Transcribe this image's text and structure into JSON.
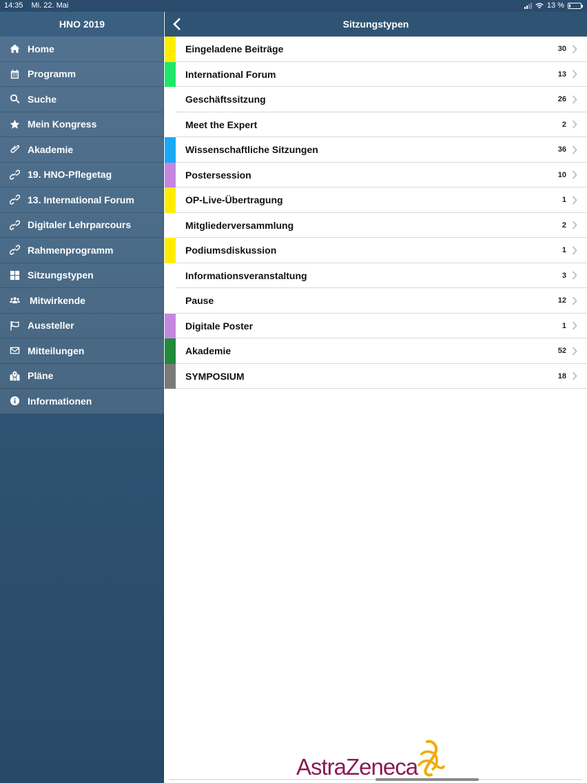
{
  "status_bar": {
    "time": "14:35",
    "date": "Mi. 22. Mai",
    "battery": "13 %",
    "battery_level": 0.13
  },
  "sidebar": {
    "title": "HNO 2019",
    "items": [
      {
        "label": "Home",
        "icon": "home-icon"
      },
      {
        "label": "Programm",
        "icon": "calendar-icon"
      },
      {
        "label": "Suche",
        "icon": "search-icon"
      },
      {
        "label": "Mein Kongress",
        "icon": "star-icon"
      },
      {
        "label": "Akademie",
        "icon": "paperclip-icon"
      },
      {
        "label": "19. HNO-Pflegetag",
        "icon": "link-icon"
      },
      {
        "label": "13. International Forum",
        "icon": "link-icon"
      },
      {
        "label": "Digitaler Lehrparcours",
        "icon": "link-icon"
      },
      {
        "label": "Rahmenprogramm",
        "icon": "link-icon"
      },
      {
        "label": "Sitzungstypen",
        "icon": "grid-icon"
      },
      {
        "label": "Mitwirkende",
        "icon": "users-icon"
      },
      {
        "label": "Aussteller",
        "icon": "flag-icon"
      },
      {
        "label": "Mitteilungen",
        "icon": "envelope-icon"
      },
      {
        "label": "Pläne",
        "icon": "map-icon"
      },
      {
        "label": "Informationen",
        "icon": "info-icon"
      }
    ]
  },
  "nav": {
    "title": "Sitzungstypen"
  },
  "session_types": [
    {
      "label": "Eingeladene Beiträge",
      "count": "30",
      "color": "#ffed00"
    },
    {
      "label": "International Forum",
      "count": "13",
      "color": "#1ee86a"
    },
    {
      "label": "Geschäftssitzung",
      "count": "26",
      "color": ""
    },
    {
      "label": "Meet the Expert",
      "count": "2",
      "color": ""
    },
    {
      "label": "Wissenschaftliche Sitzungen",
      "count": "36",
      "color": "#1aa9f5"
    },
    {
      "label": "Postersession",
      "count": "10",
      "color": "#c487e0"
    },
    {
      "label": "OP-Live-Übertragung",
      "count": "1",
      "color": "#ffed00"
    },
    {
      "label": "Mitgliederversammlung",
      "count": "2",
      "color": ""
    },
    {
      "label": "Podiumsdiskussion",
      "count": "1",
      "color": "#ffed00"
    },
    {
      "label": "Informationsveranstaltung",
      "count": "3",
      "color": ""
    },
    {
      "label": "Pause",
      "count": "12",
      "color": ""
    },
    {
      "label": "Digitale Poster",
      "count": "1",
      "color": "#c487e0"
    },
    {
      "label": "Akademie",
      "count": "52",
      "color": "#1f8a3a"
    },
    {
      "label": "SYMPOSIUM",
      "count": "18",
      "color": "#7a7a7a"
    }
  ],
  "sponsor": {
    "name": "AstraZeneca",
    "brand_color": "#8a1b55",
    "logo_color": "#f0ab00"
  }
}
